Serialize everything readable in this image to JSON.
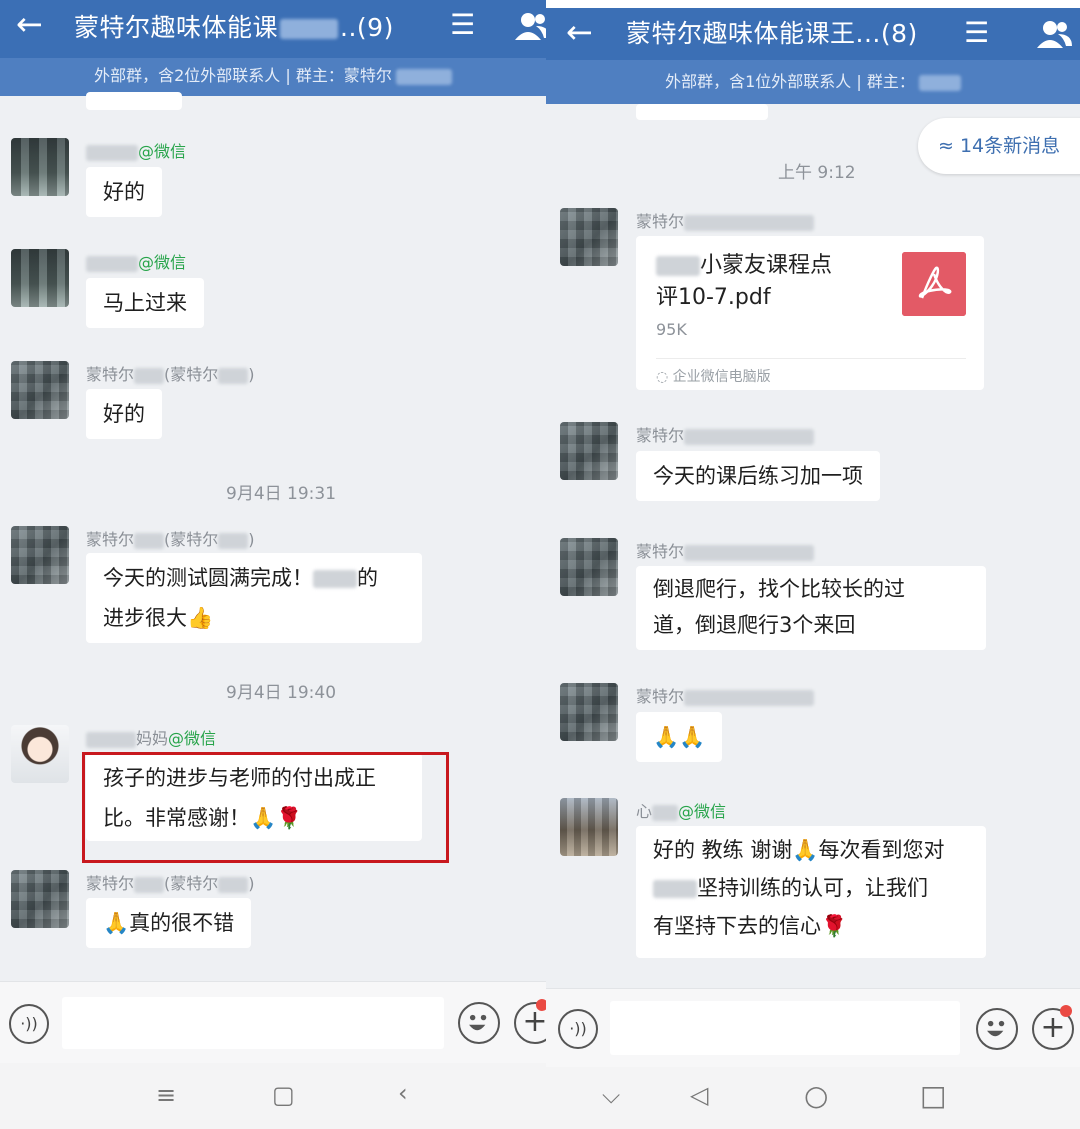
{
  "left": {
    "header": {
      "back_icon": "←",
      "title": "蒙特尔趣味体能课",
      "title_suffix": "..(9)",
      "menu_icon": "☰"
    },
    "subbar": {
      "text": "外部群，含2位外部联系人 | 群主：蒙特尔"
    },
    "messages": [
      {
        "sender_suffix": "@微信",
        "text": "好的"
      },
      {
        "sender_suffix": "@微信",
        "text": "马上过来"
      },
      {
        "sender_prefix": "蒙特尔",
        "sender_mid": "(蒙特尔",
        "sender_end": ")",
        "text": "好的"
      },
      {
        "sender_prefix": "蒙特尔",
        "sender_mid": "(蒙特尔",
        "sender_end": ")",
        "line1_a": "今天的测试圆满完成！",
        "line1_b": "的",
        "line2": "进步很大👍"
      },
      {
        "sender_mid": "妈妈",
        "sender_suffix": "@微信",
        "line1": "孩子的进步与老师的付出成正",
        "line2": "比。非常感谢！🙏🌹"
      },
      {
        "sender_prefix": "蒙特尔",
        "sender_mid": "(蒙特尔",
        "sender_end": ")",
        "text": "🙏真的很不错"
      }
    ],
    "timestamps": [
      "9月4日  19:31",
      "9月4日  19:40"
    ],
    "inputbar": {
      "voice_icon": "·))",
      "plus_icon": "+"
    },
    "navbar": {
      "menu": "≡",
      "home": "▢",
      "back": "‹"
    }
  },
  "right": {
    "header": {
      "back_icon": "←",
      "title": "蒙特尔趣味体能课王...(8)",
      "menu_icon": "☰"
    },
    "subbar": {
      "text": "外部群，含1位外部联系人 | 群主："
    },
    "new_messages": "≈ 14条新消息",
    "timestamp": "上午 9:12",
    "file_message": {
      "sender": "蒙特尔",
      "name_line1": "小蒙友课程点",
      "name_line2": "评10-7.pdf",
      "size": "95K",
      "source": "企业微信电脑版"
    },
    "messages": [
      {
        "sender": "蒙特尔",
        "text": "今天的课后练习加一项"
      },
      {
        "sender": "蒙特尔",
        "line1": "倒退爬行，找个比较长的过",
        "line2": "道，倒退爬行3个来回"
      },
      {
        "sender": "蒙特尔",
        "text": "🙏🙏"
      },
      {
        "sender_prefix": "心",
        "sender_suffix": "@微信",
        "line1": "好的 教练 谢谢🙏每次看到您对",
        "line2": "坚持训练的认可，让我们",
        "line3": "有坚持下去的信心🌹"
      }
    ],
    "inputbar": {
      "voice_icon": "·))",
      "plus_icon": "+"
    },
    "navbar": {
      "down": "⌵",
      "back": "◁",
      "home": "○",
      "recent": "□"
    }
  },
  "colors": {
    "header": "#3b6fb5",
    "subbar": "#4f7fc1",
    "wechat_tag": "#27a44a",
    "highlight": "#c8181e",
    "pdf": "#e35a66"
  }
}
